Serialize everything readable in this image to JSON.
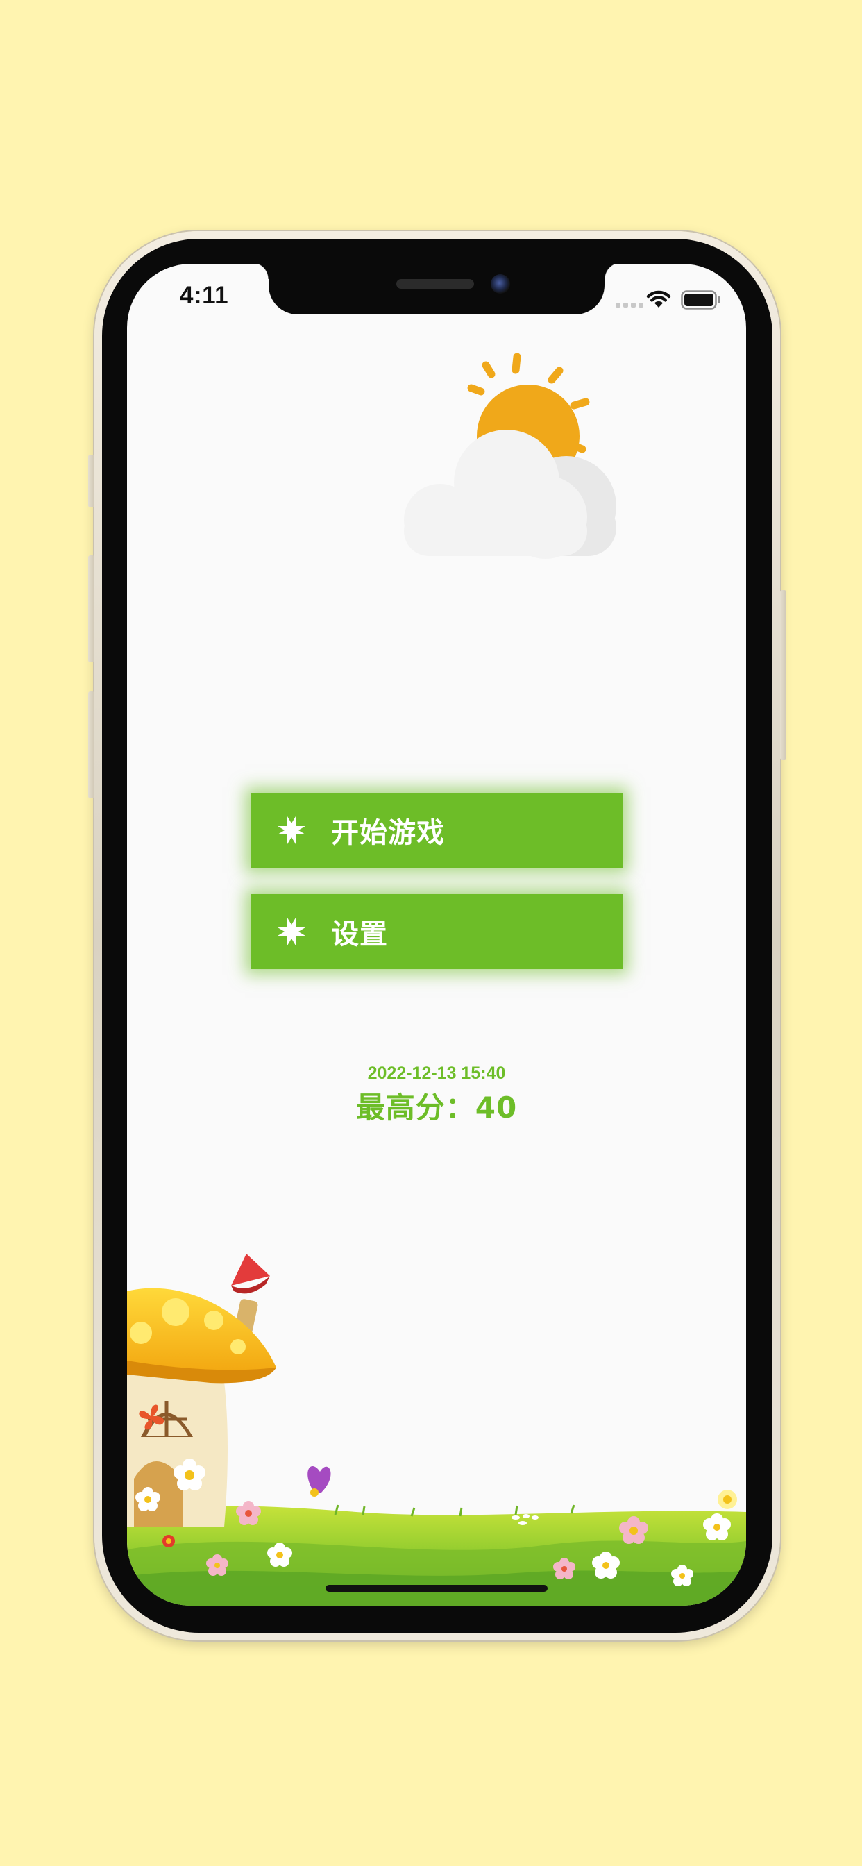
{
  "status_bar": {
    "time": "4:11"
  },
  "menu": {
    "start_label": "开始游戏",
    "settings_label": "设置",
    "icon": "gamepad-icon"
  },
  "score": {
    "date": "2022-12-13 15:40",
    "high_score": "最高分：40"
  },
  "colors": {
    "background": "#FFF4B0",
    "screen": "#FAFAFA",
    "accent_green": "#6DBD28",
    "sun": "#F0A81A"
  },
  "icons": {
    "wifi": "wifi-icon",
    "battery": "battery-icon",
    "signal": "cellular-signal-icon",
    "weather": "sun-cloud-icon",
    "scenery": "mushroom-house-meadow-illustration"
  }
}
